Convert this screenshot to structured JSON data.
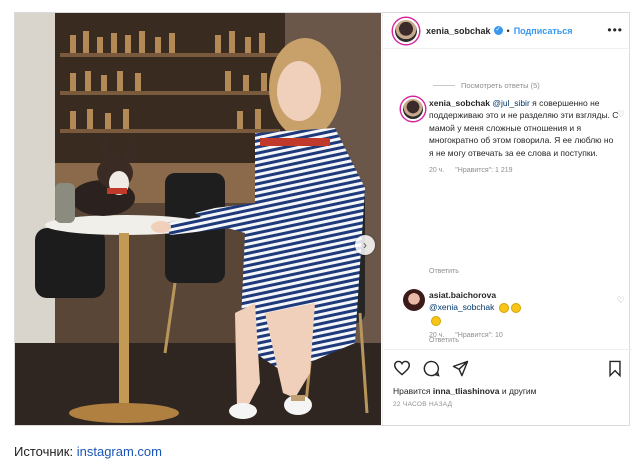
{
  "post": {
    "username": "xenia_sobchak",
    "follow_label": "Подписаться",
    "more_label": "•••"
  },
  "comments": {
    "view_replies": "Посмотреть ответы (5)",
    "reply1": {
      "username": "xenia_sobchak",
      "mention": "@jul_sibir",
      "text": "я совершенно не поддерживаю это и не разделяю эти взгляды. С мамой у меня сложные отношения и я многократно об этом говорила. Я ее люблю но я не могу отвечать за ее слова и поступки.",
      "time": "20 ч.",
      "likes": "\"Нравится\": 1 219",
      "reply": "Ответить"
    },
    "reply2": {
      "username": "asiat.baichorova",
      "mention": "@xenia_sobchak",
      "time": "20 ч.",
      "likes": "\"Нравится\": 10",
      "reply": "Ответить"
    }
  },
  "footer": {
    "liked_prefix": "Нравится",
    "liked_user": "inna_tliashinova",
    "liked_suffix": "и другим",
    "timestamp": "22 ЧАСОВ НАЗАД"
  },
  "source": {
    "label": "Источник:",
    "link": "instagram.com"
  },
  "colors": {
    "accent": "#3897f0",
    "link": "#1a55b5",
    "story_ring": "#d6249f"
  }
}
